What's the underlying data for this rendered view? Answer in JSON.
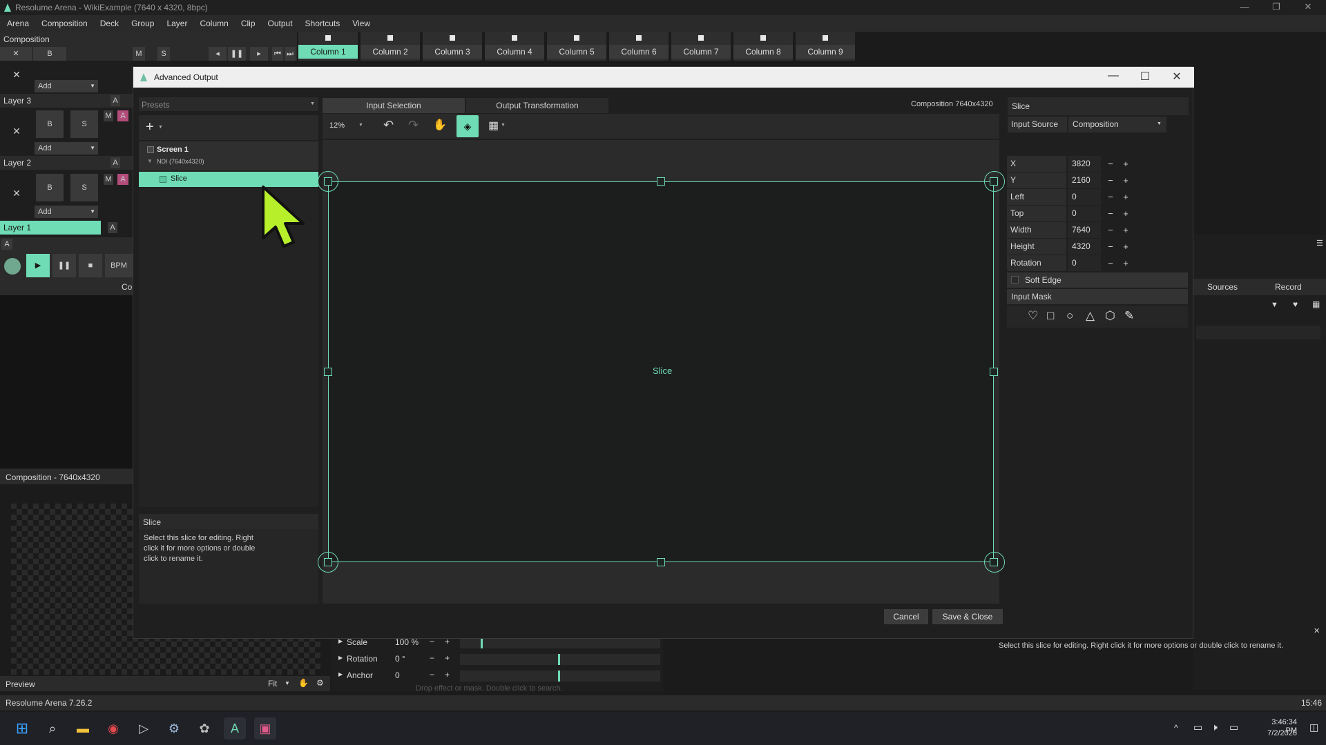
{
  "window": {
    "title": "Resolume Arena - WikiExample (7640 x 4320, 8bpc)",
    "min_icon": "minimize-icon",
    "restore_icon": "restore-icon",
    "close_icon": "close-icon"
  },
  "menu": [
    "Arena",
    "Composition",
    "Deck",
    "Group",
    "Layer",
    "Column",
    "Clip",
    "Output",
    "Shortcuts",
    "View"
  ],
  "composition_bar": {
    "label": "Composition",
    "x": "✕",
    "b": "B",
    "m": "M",
    "s": "S"
  },
  "columns": [
    "Column 1",
    "Column 2",
    "Column 3",
    "Column 4",
    "Column 5",
    "Column 6",
    "Column 7",
    "Column 8",
    "Column 9"
  ],
  "layers": [
    {
      "name": "Layer 3",
      "a": "A",
      "m": "M",
      "add": "Add",
      "b": "B",
      "s": "S"
    },
    {
      "name": "Layer 2",
      "a": "A",
      "m": "M",
      "add": "Add",
      "b": "B",
      "s": "S"
    },
    {
      "name": "Layer 1",
      "a": "A"
    }
  ],
  "top_add": "Add",
  "transport": {
    "bpm": "BPM",
    "a": "A",
    "co": "Co"
  },
  "left_panel": {
    "comp_label": "Composition - 7640x4320",
    "preview": "Preview",
    "fit": "Fit"
  },
  "status": {
    "left": "Resolume Arena 7.26.2",
    "right": "15:46"
  },
  "bottom_params": [
    {
      "name": "Scale",
      "value": "100 %"
    },
    {
      "name": "Rotation",
      "value": "0 °"
    },
    {
      "name": "Anchor",
      "value": "0"
    }
  ],
  "drop_hint": "Drop effect or mask. Double click to search.",
  "right_bg": {
    "sources": "Sources",
    "record": "Record",
    "hint": "Select this slice for editing. Right click it for more options or double click to rename it."
  },
  "dialog": {
    "title": "Advanced Output",
    "presets": "Presets",
    "tabs": [
      "Input Selection",
      "Output Transformation"
    ],
    "comp_size": "Composition 7640x4320",
    "zoom": "12%",
    "tree": {
      "screen": "Screen 1",
      "device": "NDI (7640x4320)",
      "slice": "Slice"
    },
    "info_title": "Slice",
    "info_text": "Select this slice for editing. Right click it for more options or double click to rename it.",
    "canvas_label": "Slice",
    "cancel": "Cancel",
    "save": "Save & Close",
    "props": {
      "header": "Slice",
      "input_source_label": "Input Source",
      "input_source_value": "Composition",
      "rows": [
        {
          "k": "X",
          "v": "3820"
        },
        {
          "k": "Y",
          "v": "2160"
        },
        {
          "k": "Left",
          "v": "0"
        },
        {
          "k": "Top",
          "v": "0"
        },
        {
          "k": "Width",
          "v": "7640"
        },
        {
          "k": "Height",
          "v": "4320"
        },
        {
          "k": "Rotation",
          "v": "0"
        }
      ],
      "minus": "−",
      "plus": "+",
      "soft_edge": "Soft Edge",
      "input_mask": "Input Mask"
    },
    "accent": "#6fdcb5"
  },
  "clock": {
    "time": "3:46:34 PM",
    "date": "7/2/2026"
  }
}
